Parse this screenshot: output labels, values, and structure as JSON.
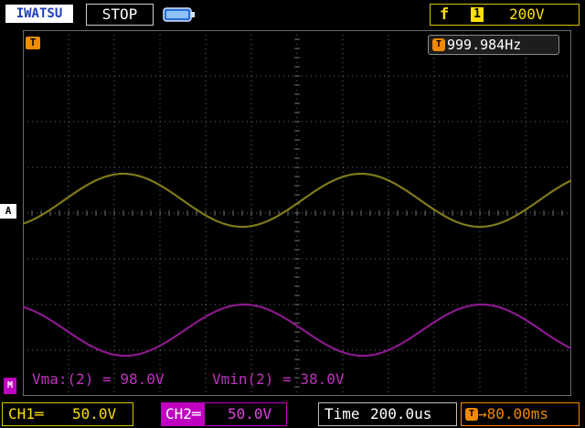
{
  "header": {
    "brand": "IWATSU",
    "run_status": "STOP",
    "trigger": {
      "edge_symbol": "f",
      "source": "1",
      "level": "200V"
    }
  },
  "screen": {
    "trigger_marker_label": "T",
    "frequency_badge": "T",
    "frequency": "999.984Hz",
    "ch1_marker": "A",
    "ch2_marker": "M",
    "measurements": {
      "vmax": "Vma:(2) = 98.0V",
      "vmin": "Vmin(2) = 38.0V"
    }
  },
  "footer": {
    "ch1": {
      "label": "CH1═",
      "scale": "50.0V"
    },
    "ch2": {
      "label": "CH2═",
      "scale": "50.0V"
    },
    "timebase": {
      "label": "Time",
      "value": "200.0us"
    },
    "trigger_delay": {
      "badge": "T",
      "value": "→80.00ms"
    }
  },
  "colors": {
    "ch1_trace": "#807a1a",
    "ch2_trace": "#8a1a8c",
    "grid": "#6a6a6a",
    "trigger": "#f08a00",
    "ch1_accent": "#ffe000",
    "ch2_accent": "#c000c0"
  },
  "icons": {
    "battery": "battery-icon",
    "trigger_position": "trigger-position-icon"
  }
}
